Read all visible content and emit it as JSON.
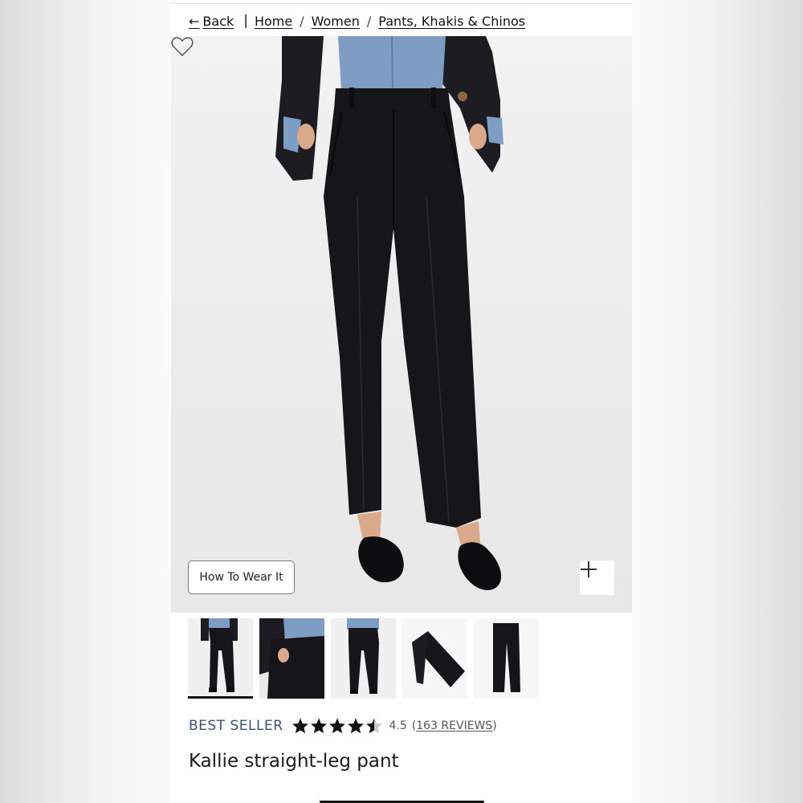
{
  "breadcrumb": {
    "back_arrow": "←",
    "back_label": "Back",
    "divider": "|",
    "items": [
      {
        "label": "Home"
      },
      {
        "label": "Women"
      },
      {
        "label": "Pants, Khakis & Chinos"
      }
    ],
    "separator": "/"
  },
  "hero": {
    "image_subject": "model wearing black straight-leg pants, navy blazer, chambray shirt, black bow mules",
    "wishlist_icon": "heart-icon",
    "how_to_wear_label": "How To Wear It",
    "zoom_icon": "plus-icon"
  },
  "thumbnails": {
    "count": 5,
    "selected_index": 0,
    "items": [
      {
        "view": "front-full",
        "active": true
      },
      {
        "view": "pocket-closeup",
        "active": false
      },
      {
        "view": "back-full",
        "active": false
      },
      {
        "view": "folded-flat",
        "active": false
      },
      {
        "view": "flat-lay",
        "active": false
      }
    ]
  },
  "product": {
    "badge": "BEST SELLER",
    "rating_value": 4.5,
    "rating_text": "4.5",
    "reviews_open": "(",
    "reviews_link": "163 REVIEWS",
    "reviews_close": ")",
    "star_count": 5,
    "title": "Kallie straight-leg pant"
  },
  "colors": {
    "badge": "#3a5276",
    "text": "#111111",
    "pants": "#16161a",
    "shirt": "#7e9dc4",
    "blazer": "#1c1c22"
  }
}
